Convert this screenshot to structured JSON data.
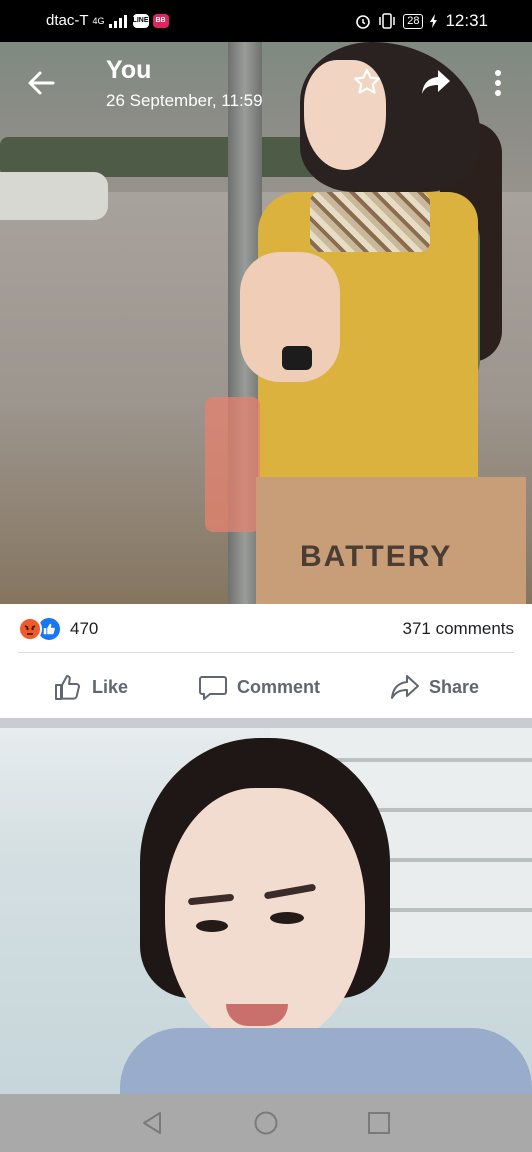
{
  "status_bar": {
    "carrier": "dtac-T",
    "network": "4G",
    "line_badge": "LINE",
    "app_badge": "BB",
    "battery": "28",
    "time": "12:31"
  },
  "post": {
    "owner": "You",
    "date": "26 September, 11:59",
    "bag_text": "BATTERY",
    "reaction_count": "470",
    "comments": "371 comments",
    "actions": {
      "like": "Like",
      "comment": "Comment",
      "share": "Share"
    }
  },
  "colors": {
    "like_blue": "#1877f2",
    "angry_orange": "#f05a2a",
    "action_gray": "#606770"
  }
}
